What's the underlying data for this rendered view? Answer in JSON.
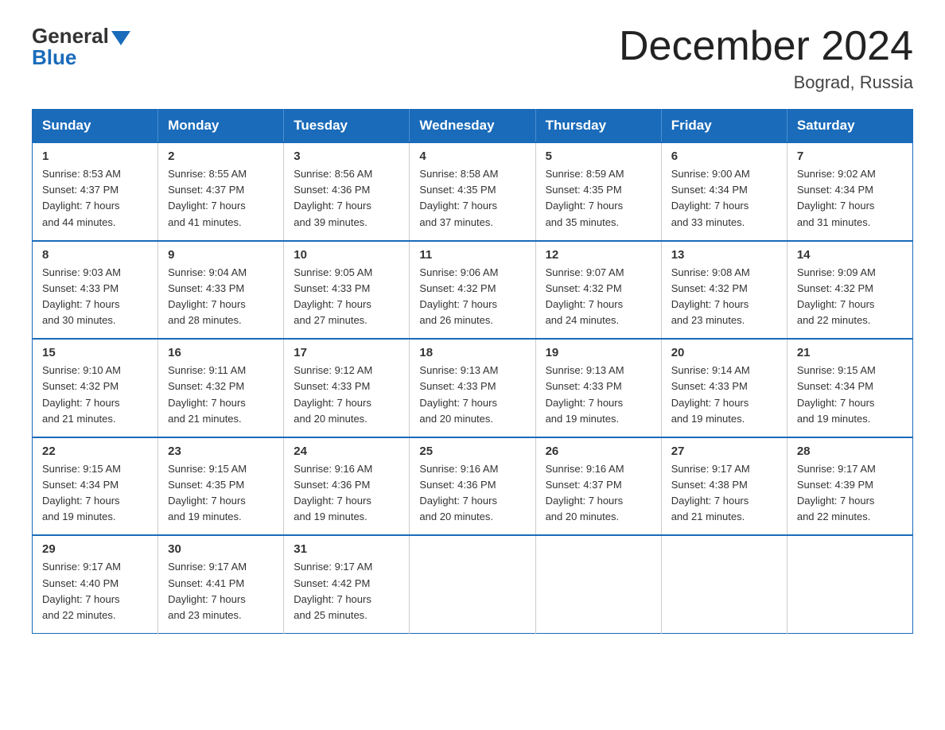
{
  "header": {
    "logo_general": "General",
    "logo_blue": "Blue",
    "month_title": "December 2024",
    "location": "Bograd, Russia"
  },
  "days_of_week": [
    "Sunday",
    "Monday",
    "Tuesday",
    "Wednesday",
    "Thursday",
    "Friday",
    "Saturday"
  ],
  "weeks": [
    [
      {
        "day": "1",
        "sunrise": "8:53 AM",
        "sunset": "4:37 PM",
        "daylight": "7 hours and 44 minutes."
      },
      {
        "day": "2",
        "sunrise": "8:55 AM",
        "sunset": "4:37 PM",
        "daylight": "7 hours and 41 minutes."
      },
      {
        "day": "3",
        "sunrise": "8:56 AM",
        "sunset": "4:36 PM",
        "daylight": "7 hours and 39 minutes."
      },
      {
        "day": "4",
        "sunrise": "8:58 AM",
        "sunset": "4:35 PM",
        "daylight": "7 hours and 37 minutes."
      },
      {
        "day": "5",
        "sunrise": "8:59 AM",
        "sunset": "4:35 PM",
        "daylight": "7 hours and 35 minutes."
      },
      {
        "day": "6",
        "sunrise": "9:00 AM",
        "sunset": "4:34 PM",
        "daylight": "7 hours and 33 minutes."
      },
      {
        "day": "7",
        "sunrise": "9:02 AM",
        "sunset": "4:34 PM",
        "daylight": "7 hours and 31 minutes."
      }
    ],
    [
      {
        "day": "8",
        "sunrise": "9:03 AM",
        "sunset": "4:33 PM",
        "daylight": "7 hours and 30 minutes."
      },
      {
        "day": "9",
        "sunrise": "9:04 AM",
        "sunset": "4:33 PM",
        "daylight": "7 hours and 28 minutes."
      },
      {
        "day": "10",
        "sunrise": "9:05 AM",
        "sunset": "4:33 PM",
        "daylight": "7 hours and 27 minutes."
      },
      {
        "day": "11",
        "sunrise": "9:06 AM",
        "sunset": "4:32 PM",
        "daylight": "7 hours and 26 minutes."
      },
      {
        "day": "12",
        "sunrise": "9:07 AM",
        "sunset": "4:32 PM",
        "daylight": "7 hours and 24 minutes."
      },
      {
        "day": "13",
        "sunrise": "9:08 AM",
        "sunset": "4:32 PM",
        "daylight": "7 hours and 23 minutes."
      },
      {
        "day": "14",
        "sunrise": "9:09 AM",
        "sunset": "4:32 PM",
        "daylight": "7 hours and 22 minutes."
      }
    ],
    [
      {
        "day": "15",
        "sunrise": "9:10 AM",
        "sunset": "4:32 PM",
        "daylight": "7 hours and 21 minutes."
      },
      {
        "day": "16",
        "sunrise": "9:11 AM",
        "sunset": "4:32 PM",
        "daylight": "7 hours and 21 minutes."
      },
      {
        "day": "17",
        "sunrise": "9:12 AM",
        "sunset": "4:33 PM",
        "daylight": "7 hours and 20 minutes."
      },
      {
        "day": "18",
        "sunrise": "9:13 AM",
        "sunset": "4:33 PM",
        "daylight": "7 hours and 20 minutes."
      },
      {
        "day": "19",
        "sunrise": "9:13 AM",
        "sunset": "4:33 PM",
        "daylight": "7 hours and 19 minutes."
      },
      {
        "day": "20",
        "sunrise": "9:14 AM",
        "sunset": "4:33 PM",
        "daylight": "7 hours and 19 minutes."
      },
      {
        "day": "21",
        "sunrise": "9:15 AM",
        "sunset": "4:34 PM",
        "daylight": "7 hours and 19 minutes."
      }
    ],
    [
      {
        "day": "22",
        "sunrise": "9:15 AM",
        "sunset": "4:34 PM",
        "daylight": "7 hours and 19 minutes."
      },
      {
        "day": "23",
        "sunrise": "9:15 AM",
        "sunset": "4:35 PM",
        "daylight": "7 hours and 19 minutes."
      },
      {
        "day": "24",
        "sunrise": "9:16 AM",
        "sunset": "4:36 PM",
        "daylight": "7 hours and 19 minutes."
      },
      {
        "day": "25",
        "sunrise": "9:16 AM",
        "sunset": "4:36 PM",
        "daylight": "7 hours and 20 minutes."
      },
      {
        "day": "26",
        "sunrise": "9:16 AM",
        "sunset": "4:37 PM",
        "daylight": "7 hours and 20 minutes."
      },
      {
        "day": "27",
        "sunrise": "9:17 AM",
        "sunset": "4:38 PM",
        "daylight": "7 hours and 21 minutes."
      },
      {
        "day": "28",
        "sunrise": "9:17 AM",
        "sunset": "4:39 PM",
        "daylight": "7 hours and 22 minutes."
      }
    ],
    [
      {
        "day": "29",
        "sunrise": "9:17 AM",
        "sunset": "4:40 PM",
        "daylight": "7 hours and 22 minutes."
      },
      {
        "day": "30",
        "sunrise": "9:17 AM",
        "sunset": "4:41 PM",
        "daylight": "7 hours and 23 minutes."
      },
      {
        "day": "31",
        "sunrise": "9:17 AM",
        "sunset": "4:42 PM",
        "daylight": "7 hours and 25 minutes."
      },
      null,
      null,
      null,
      null
    ]
  ],
  "labels": {
    "sunrise": "Sunrise:",
    "sunset": "Sunset:",
    "daylight": "Daylight:"
  }
}
